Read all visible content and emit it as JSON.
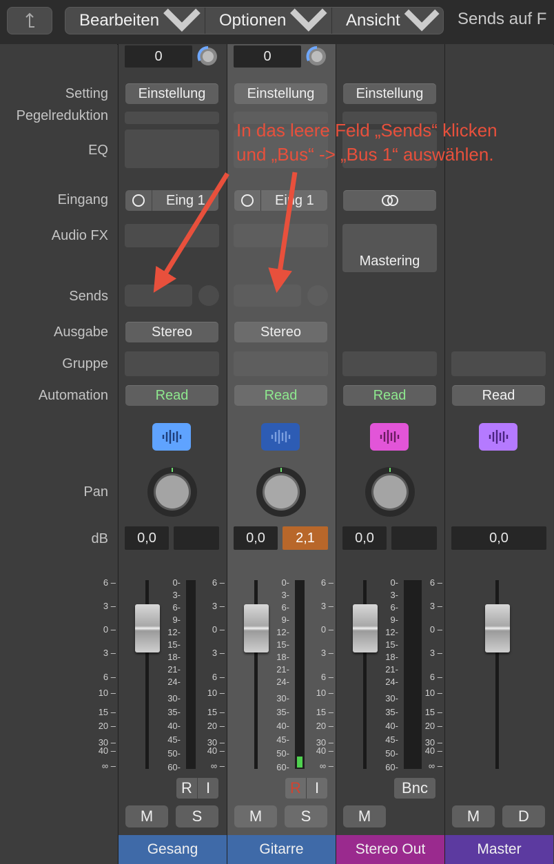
{
  "toolbar": {
    "back_icon": "back-arrow-icon",
    "edit": "Bearbeiten",
    "options": "Optionen",
    "view": "Ansicht",
    "sends_on": "Sends auf F"
  },
  "labels": {
    "setting": "Setting",
    "gain_reduction": "Pegelreduktion",
    "eq": "EQ",
    "input": "Eingang",
    "audio_fx": "Audio FX",
    "sends": "Sends",
    "output": "Ausgabe",
    "group": "Gruppe",
    "automation": "Automation",
    "pan": "Pan",
    "db": "dB"
  },
  "annotation": {
    "line1": "In das leere Feld „Sends“ klicken",
    "line2": "und „Bus“ -> „Bus 1“ auswählen.",
    "color": "#e8503c"
  },
  "scale_fader": [
    "6",
    "3",
    "0",
    "3",
    "6",
    "10",
    "15",
    "20",
    "30",
    "40",
    "∞"
  ],
  "scale_meter": [
    "0",
    "3",
    "6",
    "9",
    "12",
    "15",
    "18",
    "21",
    "24",
    "30",
    "35",
    "40",
    "45",
    "50",
    "60"
  ],
  "strips": [
    {
      "name": "Gesang",
      "name_color": "#3f6aa8",
      "top_value": "0",
      "setting": "Einstellung",
      "input": "Eing 1",
      "output": "Stereo",
      "automation": "Read",
      "icon_color": "#5fa3ff",
      "volume": "0,0",
      "peak": "",
      "rec": "R",
      "input_mon": "I",
      "mute": "M",
      "solo": "S"
    },
    {
      "name": "Gitarre",
      "name_color": "#3f6aa8",
      "top_value": "0",
      "setting": "Einstellung",
      "input": "Eing 1",
      "output": "Stereo",
      "automation": "Read",
      "icon_color": "#2d5cb4",
      "volume": "0,0",
      "peak": "2,1",
      "rec": "R",
      "input_mon": "I",
      "mute": "M",
      "solo": "S"
    },
    {
      "name": "Stereo Out",
      "name_color": "#9a2a8e",
      "setting": "Einstellung",
      "audio_fx": "Mastering",
      "automation": "Read",
      "icon_color": "#e255d8",
      "volume": "0,0",
      "peak": "",
      "bounce": "Bnc",
      "mute": "M"
    },
    {
      "name": "Master",
      "name_color": "#5c3aa0",
      "automation": "Read",
      "icon_color": "#b57aff",
      "volume": "0,0",
      "mute": "M",
      "dim": "D"
    }
  ]
}
